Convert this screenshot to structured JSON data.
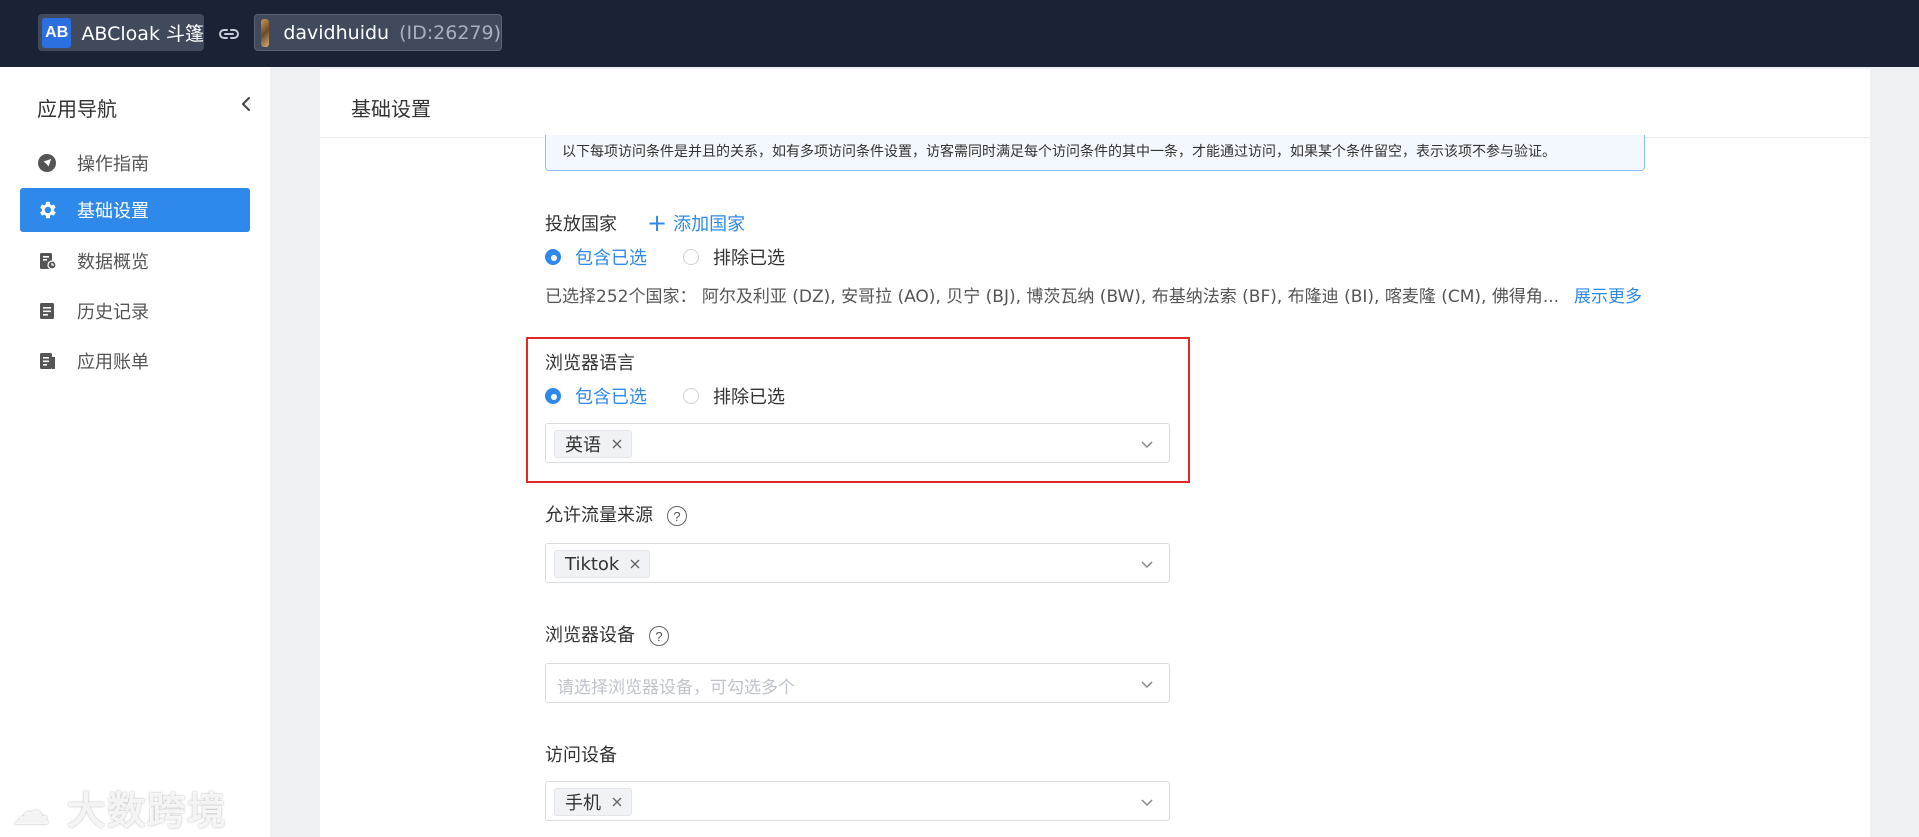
{
  "topbar": {
    "brand_logo": "AB",
    "brand_name": "ABCloak 斗篷",
    "account_name": "davidhuidu",
    "account_id": "(ID:26279)",
    "bg_color": "#1b2236"
  },
  "sidebar": {
    "title": "应用导航",
    "items": [
      {
        "label": "操作指南",
        "icon": "navigation-icon",
        "active": false
      },
      {
        "label": "基础设置",
        "icon": "gear-icon",
        "active": true
      },
      {
        "label": "数据概览",
        "icon": "data-report-icon",
        "active": false
      },
      {
        "label": "历史记录",
        "icon": "document-icon",
        "active": false
      },
      {
        "label": "应用账单",
        "icon": "bill-icon",
        "active": false
      }
    ],
    "active_color": "#2e89ea"
  },
  "main": {
    "title": "基础设置",
    "notice": "以下每项访问条件是并且的关系，如有多项访问条件设置，访客需同时满足每个访问条件的其中一条，才能通过访问，如果某个条件留空，表示该项不参与验证。",
    "countries": {
      "label": "投放国家",
      "add_label": "添加国家",
      "include_label": "包含已选",
      "exclude_label": "排除已选",
      "selected": "include",
      "selected_text": "已选择252个国家：  阿尔及利亚 (DZ), 安哥拉 (AO), 贝宁 (BJ), 博茨瓦纳 (BW), 布基纳法索 (BF), 布隆迪 (BI), 喀麦隆 (CM), 佛得角...",
      "show_more": "展示更多"
    },
    "browser_language": {
      "label": "浏览器语言",
      "include_label": "包含已选",
      "exclude_label": "排除已选",
      "selected": "include",
      "tags": [
        "英语"
      ]
    },
    "traffic_source": {
      "label": "允许流量来源",
      "help": "?",
      "tags": [
        "Tiktok"
      ]
    },
    "browser_device": {
      "label": "浏览器设备",
      "help": "?",
      "placeholder": "请选择浏览器设备，可勾选多个"
    },
    "access_device": {
      "label": "访问设备",
      "tags": [
        "手机"
      ]
    }
  },
  "watermark": "大数跨境"
}
